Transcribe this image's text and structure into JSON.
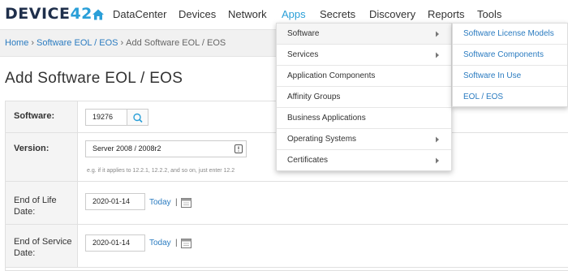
{
  "brand": {
    "logo_text": "DEVICE",
    "logo_num": "42"
  },
  "nav": {
    "items": [
      "DataCenter",
      "Devices",
      "Network",
      "Apps",
      "Secrets",
      "Discovery",
      "Reports",
      "Tools"
    ],
    "active": "Apps"
  },
  "breadcrumb": {
    "home": "Home",
    "section": "Software EOL / EOS",
    "current": "Add Software EOL / EOS",
    "separator": "›"
  },
  "page": {
    "title": "Add Software EOL / EOS"
  },
  "form": {
    "software": {
      "label": "Software:",
      "value": "19276"
    },
    "version": {
      "label": "Version:",
      "value": "Server 2008 / 2008r2",
      "help": "e.g. if it applies to 12.2.1, 12.2.2, and so on, just enter 12.2"
    },
    "eol": {
      "label_line1": "End of Life",
      "label_line2": "Date:",
      "value": "2020-01-14",
      "today": "Today",
      "pipe": "|"
    },
    "eos": {
      "label_line1": "End of Service",
      "label_line2": "Date:",
      "value": "2020-01-14",
      "today": "Today",
      "pipe": "|"
    }
  },
  "apps_menu": {
    "items": [
      "Software",
      "Services",
      "Application Components",
      "Affinity Groups",
      "Business Applications",
      "Operating Systems",
      "Certificates"
    ],
    "has_submenu": [
      true,
      true,
      false,
      false,
      false,
      true,
      true
    ]
  },
  "software_submenu": {
    "items": [
      "Software License Models",
      "Software Components",
      "Software In Use",
      "EOL / EOS"
    ]
  },
  "colors": {
    "accent": "#2a9fd8",
    "link": "#2a7bc0",
    "logo_dark": "#1f2f4b"
  }
}
